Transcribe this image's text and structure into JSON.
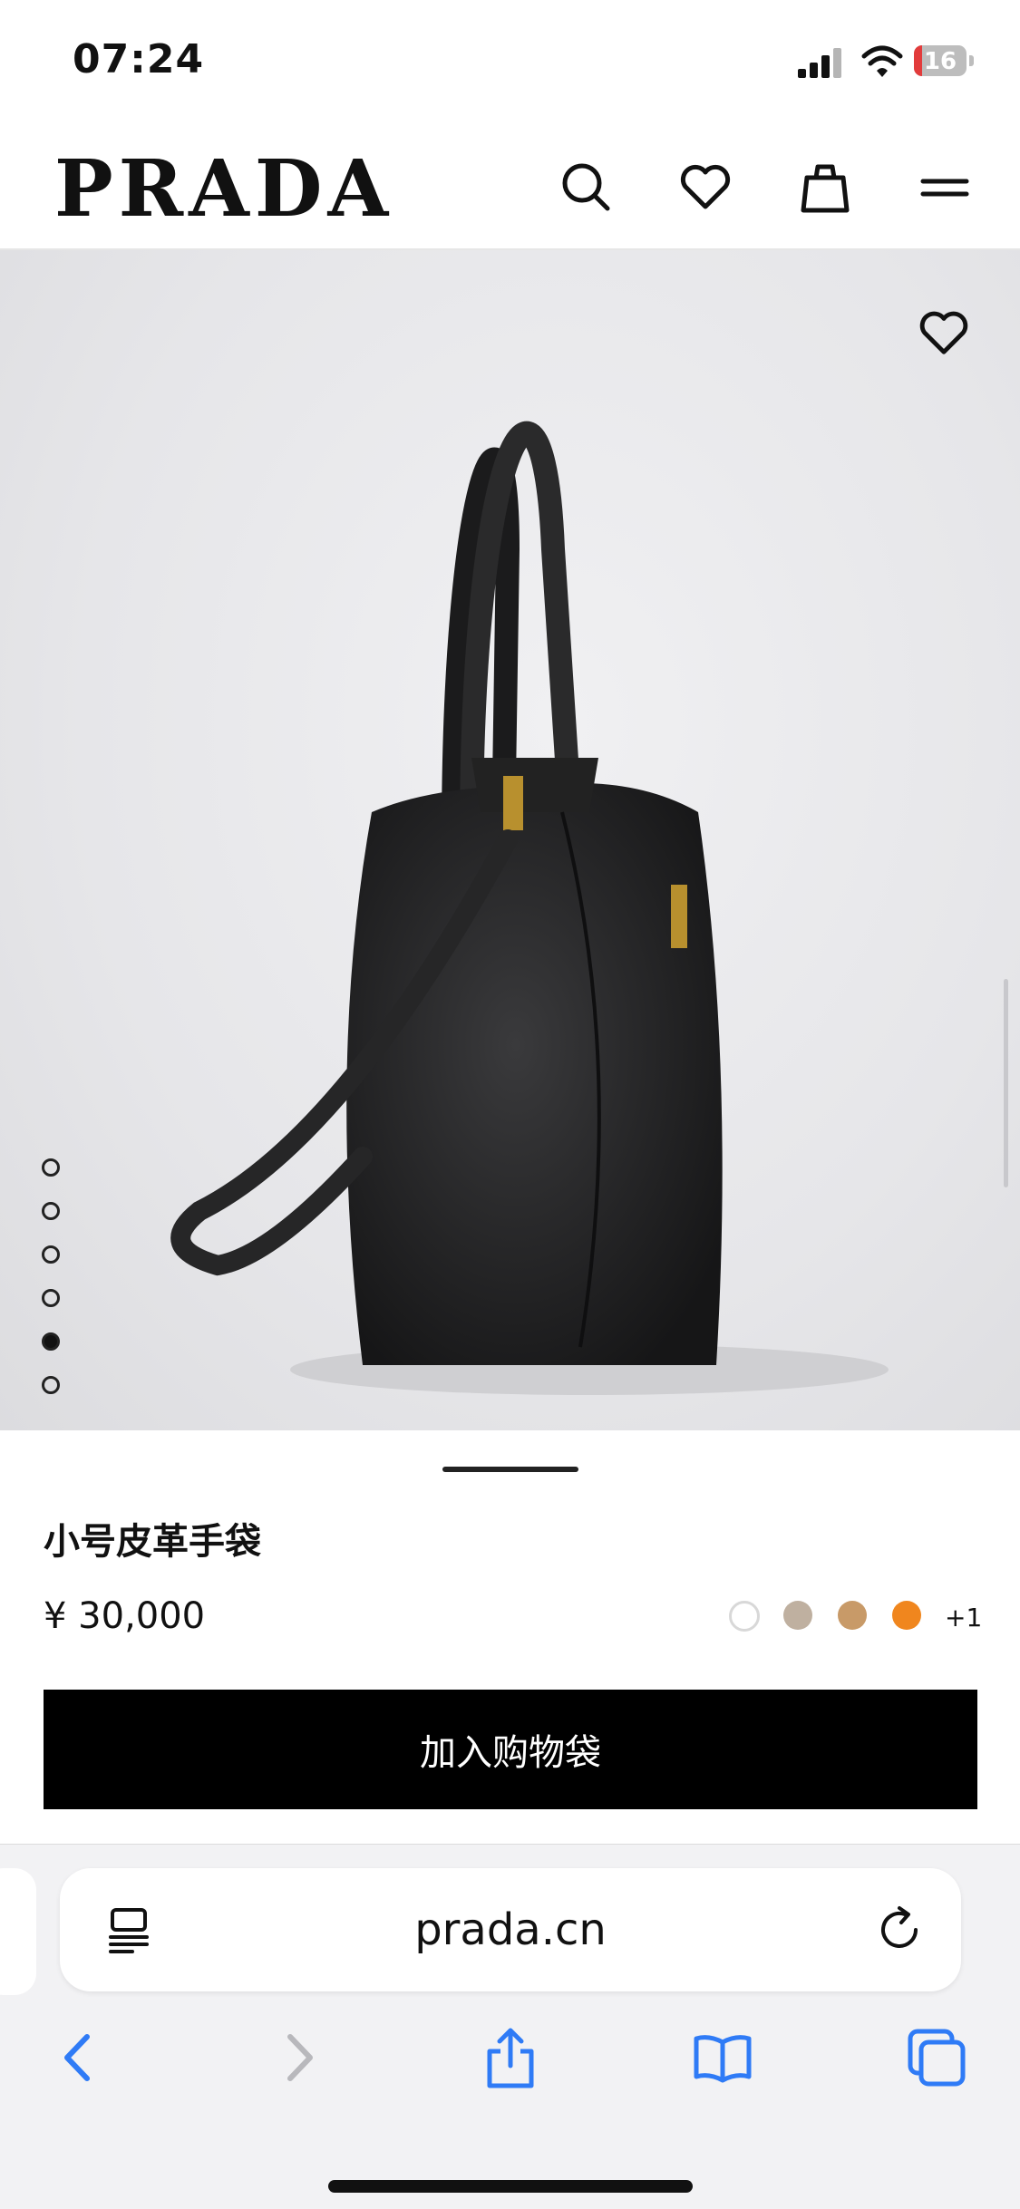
{
  "status_bar": {
    "time": "07:24",
    "battery_label": "16",
    "battery_level": 0.16
  },
  "header": {
    "brand": "PRADA",
    "icons": [
      "search-icon",
      "heart-icon",
      "shopping-bag-icon",
      "menu-icon"
    ]
  },
  "gallery": {
    "image_subject": "black leather handbag",
    "slides_total": 6,
    "active_slide": 5
  },
  "product": {
    "name": "小号皮革手袋",
    "price": "¥ 30,000",
    "colors": [
      "#ffffff",
      "#bfb0a0",
      "#c89a68",
      "#f0861e"
    ],
    "more_colors": "+1",
    "add_to_bag": "加入购物袋"
  },
  "browser": {
    "url": "prada.cn",
    "toolbar_icons": [
      "back-icon",
      "forward-icon",
      "share-icon",
      "bookmarks-icon",
      "tabs-icon"
    ]
  }
}
